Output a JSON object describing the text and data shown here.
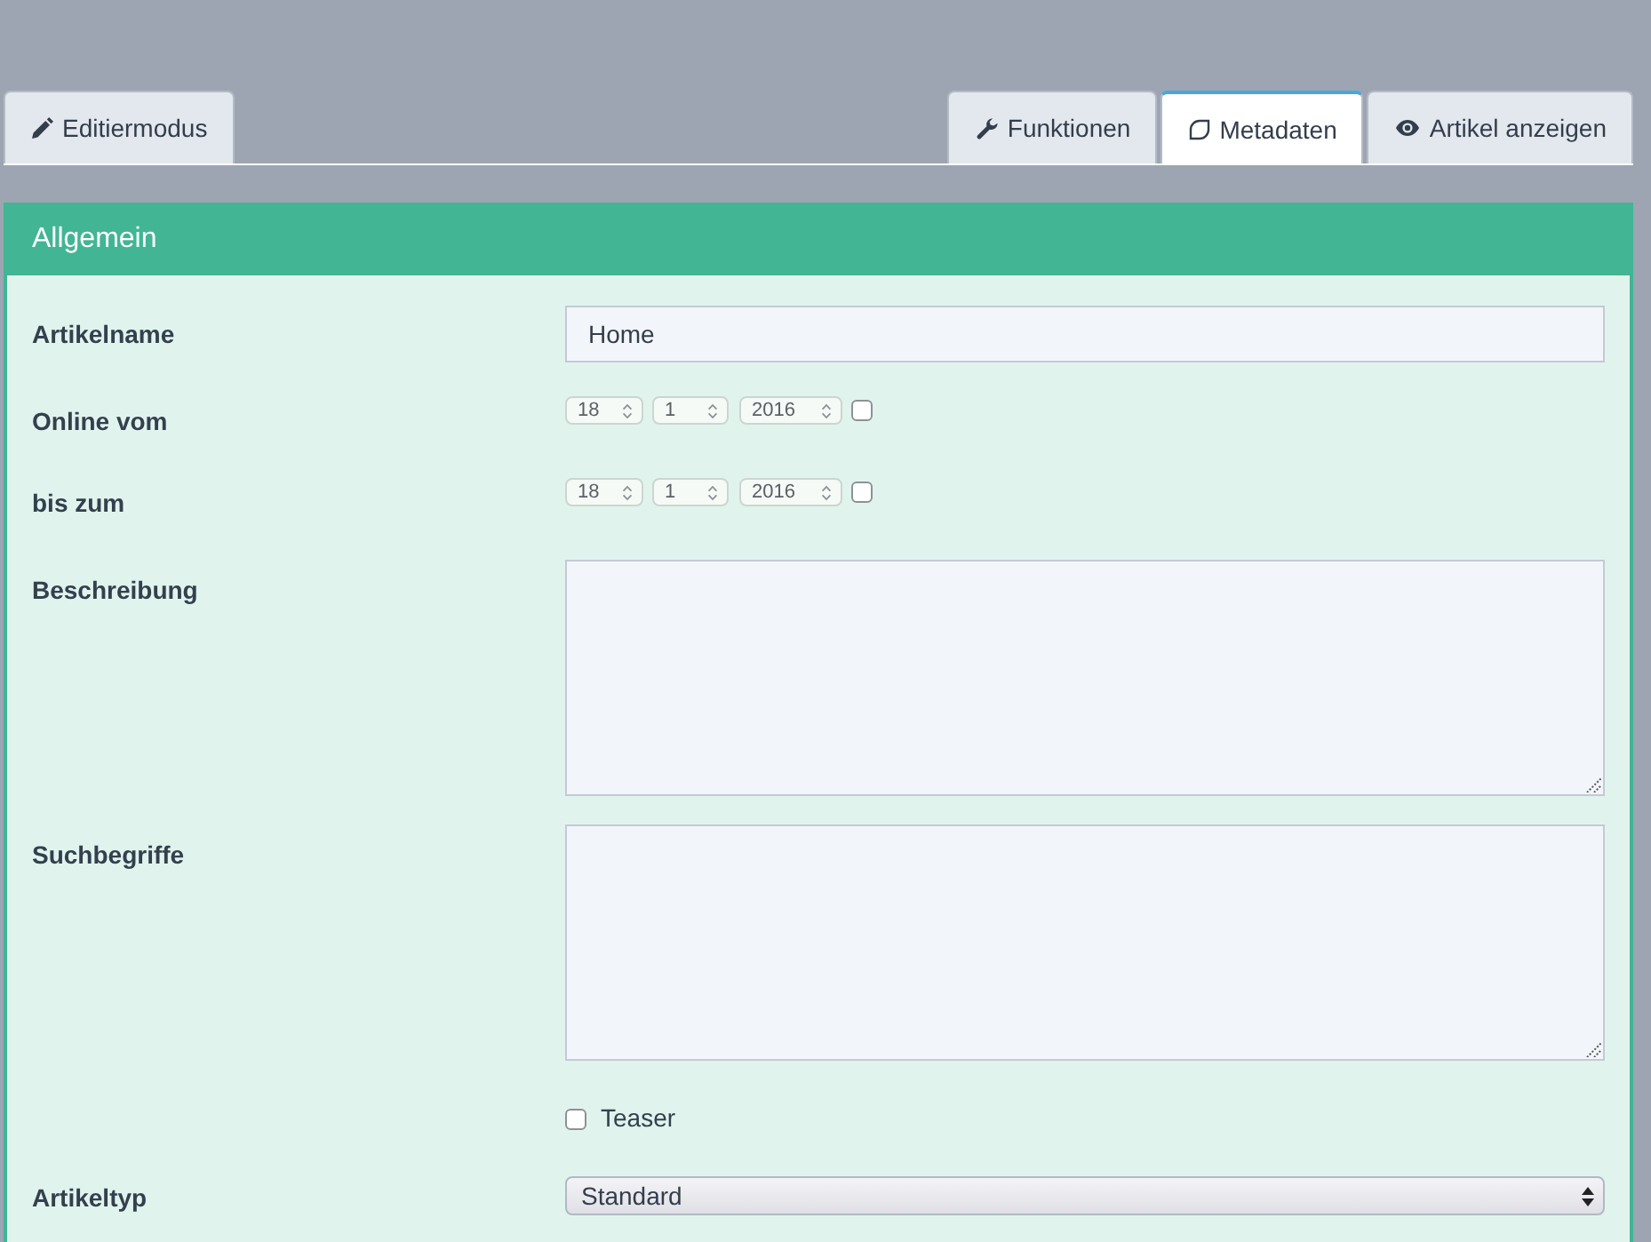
{
  "left_tabs": [
    {
      "label": "Editiermodus",
      "kind": "edit",
      "selected": false
    }
  ],
  "right_tabs": [
    {
      "label": "Funktionen",
      "kind": "functions",
      "selected": false
    },
    {
      "label": "Metadaten",
      "kind": "metadata",
      "selected": true
    },
    {
      "label": "Artikel anzeigen",
      "kind": "preview",
      "selected": false
    }
  ],
  "panel": {
    "title": "Allgemein",
    "fields": [
      {
        "kind": "text",
        "label": "Artikelname",
        "value": "Home"
      },
      {
        "kind": "date",
        "label": "Online vom",
        "day": "18",
        "month": "1",
        "year": "2016",
        "checked": false
      },
      {
        "kind": "date",
        "label": "bis zum",
        "day": "18",
        "month": "1",
        "year": "2016",
        "checked": false
      },
      {
        "kind": "textarea",
        "label": "Beschreibung"
      },
      {
        "kind": "textarea",
        "label": "Suchbegriffe"
      },
      {
        "kind": "checkbox",
        "label": "Teaser",
        "checked": false
      },
      {
        "kind": "select",
        "label": "Artikeltyp",
        "value": "Standard"
      }
    ]
  }
}
